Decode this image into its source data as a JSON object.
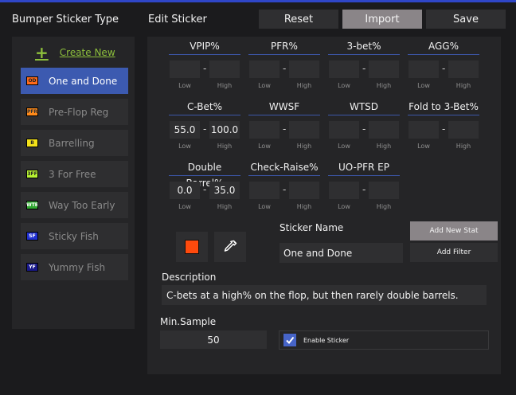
{
  "colors": {
    "accent": "#3c5ab0",
    "create_new": "#8dbf3c",
    "sticker_color": "#ff4a0d",
    "import_button_bg": "#8a8588"
  },
  "sidebar": {
    "title": "Bumper Sticker Type",
    "create_new": "Create New",
    "items": [
      {
        "label": "One and Done",
        "badge": "OD",
        "badge_bg": "#ff6a1a",
        "badge_fg": "#222222",
        "active": true
      },
      {
        "label": "Pre-Flop Reg",
        "badge": "PFR",
        "badge_bg": "#ff8a1a",
        "badge_fg": "#333333"
      },
      {
        "label": "Barrelling",
        "badge": "B",
        "badge_bg": "#f3e11a",
        "badge_fg": "#222222"
      },
      {
        "label": "3 For Free",
        "badge": "3FF",
        "badge_bg": "#b7f232",
        "badge_fg": "#222222"
      },
      {
        "label": "Way Too Early",
        "badge": "WTE",
        "badge_bg": "#2fa82f",
        "badge_fg": "#ffffff"
      },
      {
        "label": "Sticky Fish",
        "badge": "SF",
        "badge_bg": "#2030d0",
        "badge_fg": "#ffffff"
      },
      {
        "label": "Yummy Fish",
        "badge": "YF",
        "badge_bg": "#1a1a8a",
        "badge_fg": "#ffffff"
      }
    ]
  },
  "editor": {
    "title": "Edit Sticker",
    "reset_label": "Reset",
    "import_label": "Import",
    "save_label": "Save",
    "low_label": "Low",
    "high_label": "High",
    "dash": "-",
    "stats": [
      {
        "name": "VPIP%",
        "low": "",
        "high": ""
      },
      {
        "name": "PFR%",
        "low": "",
        "high": ""
      },
      {
        "name": "3-bet%",
        "low": "",
        "high": ""
      },
      {
        "name": "AGG%",
        "low": "",
        "high": ""
      },
      {
        "name": "C-Bet%",
        "low": "55.0",
        "high": "100.0"
      },
      {
        "name": "WWSF",
        "low": "",
        "high": ""
      },
      {
        "name": "WTSD",
        "low": "",
        "high": ""
      },
      {
        "name": "Fold to 3-Bet%",
        "low": "",
        "high": ""
      },
      {
        "name": "Double Barrel%",
        "low": "0.0",
        "high": "35.0"
      },
      {
        "name": "Check-Raise%",
        "low": "",
        "high": ""
      },
      {
        "name": "UO-PFR EP",
        "low": "",
        "high": ""
      }
    ],
    "sticker_name_label": "Sticker Name",
    "sticker_name_value": "One and Done",
    "add_new_stat_label": "Add New Stat",
    "add_filter_label": "Add Filter",
    "description_label": "Description",
    "description_value": "C-bets at a high% on the flop, but then rarely double barrels.",
    "min_sample_label": "Min.Sample",
    "min_sample_value": "50",
    "enable_sticker_label": "Enable Sticker",
    "enable_sticker_checked": true
  }
}
